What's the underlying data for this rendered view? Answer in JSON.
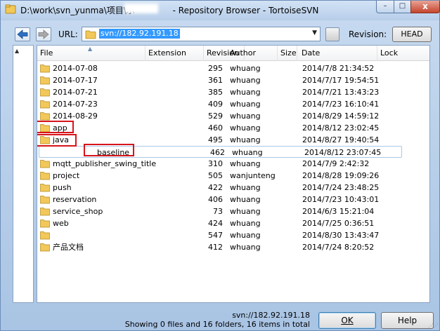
{
  "window": {
    "title_path": "D:\\work\\svn_yunma\\项目\\示",
    "title_app": " - Repository Browser - TortoiseSVN",
    "controls": {
      "minimize": "–",
      "maximize": "□",
      "close": "x"
    }
  },
  "toolbar": {
    "url_label": "URL:",
    "url_value": "svn://182.92.191.18",
    "revision_label": "Revision:",
    "head_button": "HEAD"
  },
  "columns": [
    "File",
    "Extension",
    "Revision",
    "Author",
    "Size",
    "Date",
    "Lock"
  ],
  "rows": [
    {
      "name": "2014-07-08",
      "revision": "295",
      "author": "whuang",
      "date": "2014/7/8 21:34:52"
    },
    {
      "name": "2014-07-17",
      "revision": "361",
      "author": "whuang",
      "date": "2014/7/17 19:54:51"
    },
    {
      "name": "2014-07-21",
      "revision": "385",
      "author": "whuang",
      "date": "2014/7/21 13:43:23"
    },
    {
      "name": "2014-07-23",
      "revision": "409",
      "author": "whuang",
      "date": "2014/7/23 16:10:41"
    },
    {
      "name": "2014-08-29",
      "revision": "529",
      "author": "whuang",
      "date": "2014/8/29 14:59:12"
    },
    {
      "name": "app",
      "revision": "460",
      "author": "whuang",
      "date": "2014/8/12 23:02:45"
    },
    {
      "name": "java",
      "revision": "495",
      "author": "whuang",
      "date": "2014/8/27 19:40:54"
    },
    {
      "name": "baseline",
      "revision": "462",
      "author": "whuang",
      "date": "2014/8/12 23:07:45"
    },
    {
      "name": "mqtt_publisher_swing_title",
      "revision": "310",
      "author": "whuang",
      "date": "2014/7/9 2:42:32"
    },
    {
      "name": "project",
      "revision": "505",
      "author": "wanjunteng",
      "date": "2014/8/28 19:09:26"
    },
    {
      "name": "push",
      "revision": "422",
      "author": "whuang",
      "date": "2014/7/24 23:48:25"
    },
    {
      "name": "reservation",
      "revision": "406",
      "author": "whuang",
      "date": "2014/7/23 10:43:01"
    },
    {
      "name": "service_shop",
      "revision": "73",
      "author": "whuang",
      "date": "2014/6/3 15:21:04"
    },
    {
      "name": "web",
      "revision": "424",
      "author": "whuang",
      "date": "2014/7/25 0:36:51"
    },
    {
      "name": "",
      "revision": "547",
      "author": "whuang",
      "date": "2014/8/30 13:43:47"
    },
    {
      "name": "产品文档",
      "revision": "412",
      "author": "whuang",
      "date": "2014/7/24 8:20:52"
    }
  ],
  "status": {
    "line1": "svn://182.92.191.18",
    "line2": "Showing 0 files and 16 folders, 16 items in total"
  },
  "buttons": {
    "ok": "OK",
    "help": "Help"
  },
  "colors": {
    "folder": "#f2c85b",
    "selection": "#3399ff",
    "annotation": "#d8141b"
  }
}
